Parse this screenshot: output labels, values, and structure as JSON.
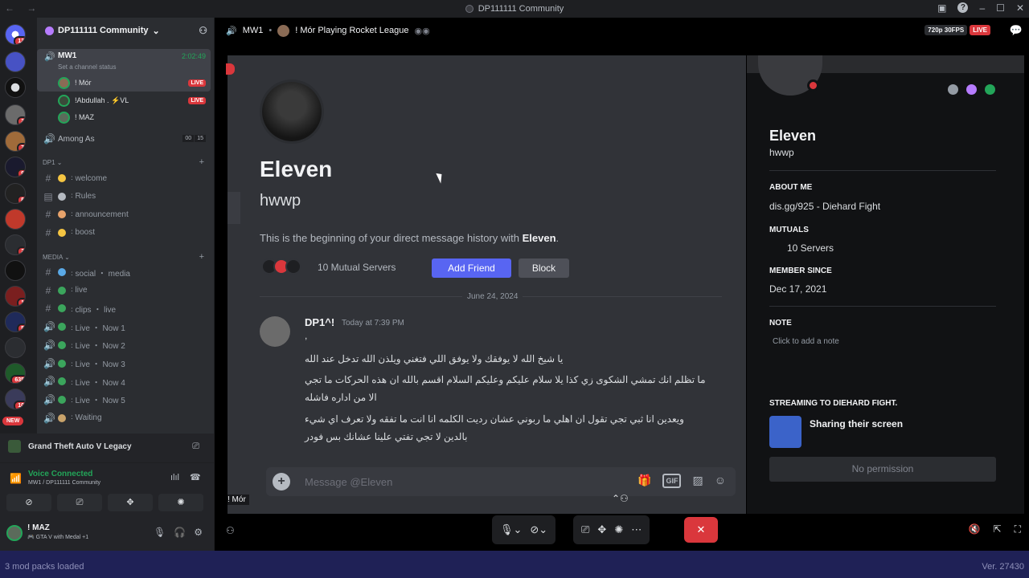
{
  "window": {
    "title": "DP111111 Community",
    "nav": "← →"
  },
  "rail": {
    "badges": [
      "13",
      "",
      "",
      "3",
      "7",
      "9",
      "8",
      "",
      "2",
      "",
      "1",
      "5",
      "",
      "635",
      "10"
    ],
    "new_label": "NEW"
  },
  "server": {
    "name": "DP111111 Community"
  },
  "voice_channel": {
    "name": "MW1",
    "status_placeholder": "Set a channel status",
    "time": "2:02:49"
  },
  "voice_users": [
    {
      "name": "! Mór",
      "live": "LIVE"
    },
    {
      "name": "!Abdullah . ⚡VL",
      "live": "LIVE"
    },
    {
      "name": "! MAZ",
      "live": ""
    }
  ],
  "among_as": {
    "name": "Among As",
    "count_a": "00",
    "count_b": "15"
  },
  "categories": {
    "dp1": "DP1",
    "media": "MEDIA"
  },
  "dp1_channels": [
    {
      "icon": "#",
      "emoji_color": "#f5c542",
      "name": "꞉ welcome"
    },
    {
      "icon": "▤",
      "emoji_color": "#b5bac1",
      "name": "꞉ Rules"
    },
    {
      "icon": "#",
      "emoji_color": "#e8a36b",
      "name": "꞉ announcement"
    },
    {
      "icon": "#",
      "emoji_color": "#f5c542",
      "name": "꞉ boost"
    }
  ],
  "media_channels": [
    {
      "icon": "#",
      "emoji_color": "#5aa9e6",
      "name": "꞉ social ・ media"
    },
    {
      "icon": "#",
      "emoji_color": "#3ba55c",
      "name": "꞉ live"
    },
    {
      "icon": "#",
      "emoji_color": "#3ba55c",
      "name": "꞉ clips ・ live"
    },
    {
      "icon": "🔊",
      "emoji_color": "#3ba55c",
      "name": "꞉ Live ・ Now 1"
    },
    {
      "icon": "🔊",
      "emoji_color": "#3ba55c",
      "name": "꞉ Live ・ Now 2"
    },
    {
      "icon": "🔊",
      "emoji_color": "#3ba55c",
      "name": "꞉ Live ・ Now 3"
    },
    {
      "icon": "🔊",
      "emoji_color": "#3ba55c",
      "name": "꞉ Live ・ Now 4"
    },
    {
      "icon": "🔊",
      "emoji_color": "#3ba55c",
      "name": "꞉ Live ・ Now 5"
    },
    {
      "icon": "🔊",
      "emoji_color": "#c9a36b",
      "name": "꞉ Waiting"
    }
  ],
  "activity": {
    "game": "Grand Theft Auto V Legacy"
  },
  "voice": {
    "status": "Voice Connected",
    "location": "MW1 / DP111111 Community"
  },
  "user": {
    "name": "! MAZ",
    "activity": "🎮 GTA V with Medal +1"
  },
  "stage": {
    "channel": "MW1",
    "streamer": "! Mór Playing Rocket League",
    "quality": "720p 30FPS",
    "live": "LIVE",
    "nametag": "! Mór"
  },
  "chat": {
    "display_name": "Eleven",
    "username": "hwwp",
    "begin_prefix": "This is the beginning of your direct message history with ",
    "begin_name": "Eleven",
    "begin_suffix": ".",
    "mutual_servers": "10 Mutual Servers",
    "add_friend": "Add Friend",
    "block": "Block",
    "date": "June 24, 2024",
    "author": "DP1^!",
    "timestamp": "Today at 7:39 PM",
    "first_line": ",",
    "lines": [
      "يا شيخ الله لا يوفقك ولا يوفق اللي فتغني ويلذن الله تدخل عند الله",
      "ما تظلم انك تمشي الشكوى زي كذا يلا سلام عليكم وعليكم السلام اقسم بالله ان هذه الحركات ما تجي",
      "الا من اداره فاشله",
      "ويعدين انا ثبي تجي تقول ان اهلي ما ربوني عشان رديت الكلمه انا انت ما تفقه ولا تعرف اي شيء",
      "بالدين لا تجي تفتي علينا عشانك بس فودر"
    ],
    "composer_placeholder": "Message @Eleven"
  },
  "profile": {
    "name": "Eleven",
    "handle": "hwwp",
    "about_label": "ABOUT ME",
    "about": "dis.gg/925 - Diehard Fight",
    "mutuals_label": "MUTUALS",
    "mutuals": "10 Servers",
    "member_since_label": "MEMBER SINCE",
    "member_since": "Dec 17, 2021",
    "note_label": "NOTE",
    "note_placeholder": "Click to add a note",
    "streaming_label": "STREAMING TO DIEHARD FIGHT.",
    "streaming_text": "Sharing their screen",
    "no_permission": "No permission"
  },
  "statusbar": {
    "left": "3 mod packs loaded",
    "right": "Ver. 27430"
  }
}
